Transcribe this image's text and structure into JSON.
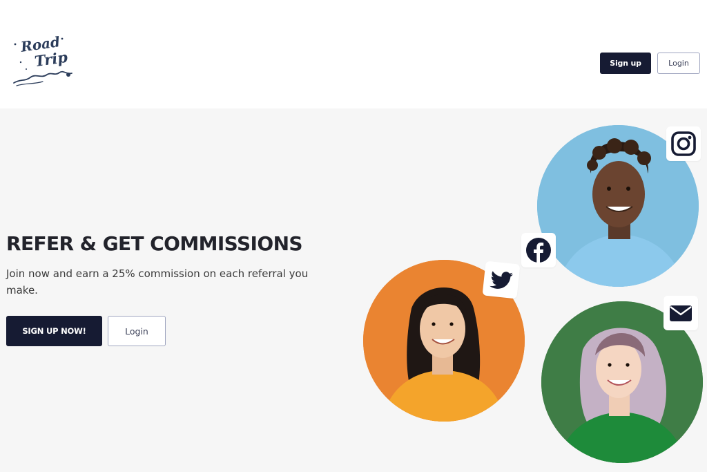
{
  "brand": {
    "logo_line1": "Road",
    "logo_line2": "Trip"
  },
  "nav": {
    "signup_label": "Sign up",
    "login_label": "Login"
  },
  "hero": {
    "title": "REFER & GET COMMISSIONS",
    "subtitle": "Join now and earn a 25% commission on each referral you make.",
    "cta_primary": "SIGN UP NOW!",
    "cta_secondary": "Login"
  },
  "social_icons": [
    "instagram-icon",
    "facebook-icon",
    "twitter-icon",
    "mail-icon"
  ],
  "colors": {
    "primary_dark": "#161b33",
    "hero_background": "#f6f6f6",
    "header_background": "#ffffff",
    "circle_blue": "#7fbfe0",
    "circle_orange": "#ea8431",
    "circle_green": "#3f7d46"
  }
}
